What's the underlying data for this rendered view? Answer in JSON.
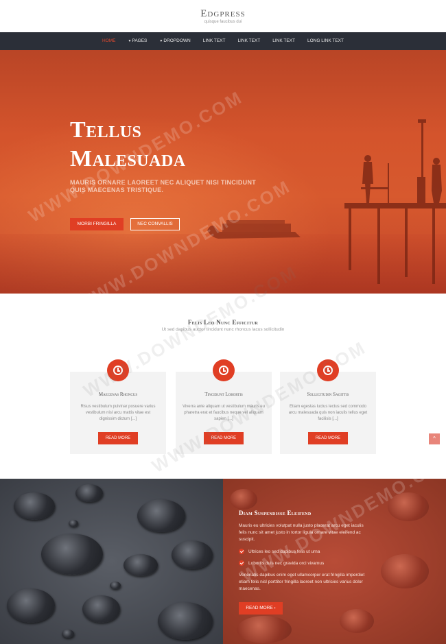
{
  "header": {
    "logo": "Edgpress",
    "tagline": "quisque faucibus dui"
  },
  "nav": {
    "items": [
      {
        "label": "HOME",
        "active": true,
        "caret": false
      },
      {
        "label": "PAGES",
        "active": false,
        "caret": true
      },
      {
        "label": "DROPDOWN",
        "active": false,
        "caret": true
      },
      {
        "label": "LINK TEXT",
        "active": false,
        "caret": false
      },
      {
        "label": "LINK TEXT",
        "active": false,
        "caret": false
      },
      {
        "label": "LINK TEXT",
        "active": false,
        "caret": false
      },
      {
        "label": "LONG LINK TEXT",
        "active": false,
        "caret": false
      }
    ]
  },
  "hero": {
    "title_line1": "Tellus",
    "title_line2": "Malesuada",
    "subtitle": "MAURIS ORNARE LAOREET NEC ALIQUET NISI TINCIDUNT QUIS MAECENAS TRISTIQUE.",
    "primary_button": "MORBI FRINGILLA",
    "secondary_button": "NEC CONVALLIS"
  },
  "features": {
    "title": "Felis Leo Nunc Efficitur",
    "subtitle": "Ut sed dapibus auctor tincidunt nunc rhoncus lacus sollicitudin",
    "cards": [
      {
        "icon": "clock-icon",
        "title": "Maecenas Rhoncus",
        "text": "Risus vestibulum pulvinar posuere varius vestibulum nisl arcu mattis vitae est dignissim dictum [...]",
        "button": "READ MORE"
      },
      {
        "icon": "clock-icon",
        "title": "Tincidunt Lobortis",
        "text": "Viverra ante aliquam ut vestibulum mauris eu pharetra erat et faucibus neque vel aliquam sapien [...]",
        "button": "READ MORE"
      },
      {
        "icon": "clock-icon",
        "title": "Sollicitudin Sagittis",
        "text": "Etiam egestas luctus lectus sed commodo arcu malesuada quis non iaculis tellus eget facilisis [...]",
        "button": "READ MORE"
      }
    ],
    "scroll_top": "^"
  },
  "split": {
    "title": "Diam Suspendisse Eleifend",
    "paragraph1": "Mauris eu ultricies volutpat nulla justo placerat arcu eget iaculis felis nunc sit amet justo in tortor ligula ornare vitae eleifend ac suscipit.",
    "checklist": [
      "Ultrices leo sed dapibus felis ut urna",
      "Lobortis duis nec gravida orci vivamus"
    ],
    "paragraph2": "Venenatis dapibus enim eget ullamcorper erat fringilla imperdiet etiam felis nisl porttitor fringilla laoreet non ultricies varius dolor maecenas.",
    "button": "READ MORE ›"
  },
  "watermark": "WWW.DOWNDEMO.COM",
  "colors": {
    "accent": "#e03e24",
    "nav_bg": "#2b2f38",
    "hero_orange": "#d4542c"
  }
}
